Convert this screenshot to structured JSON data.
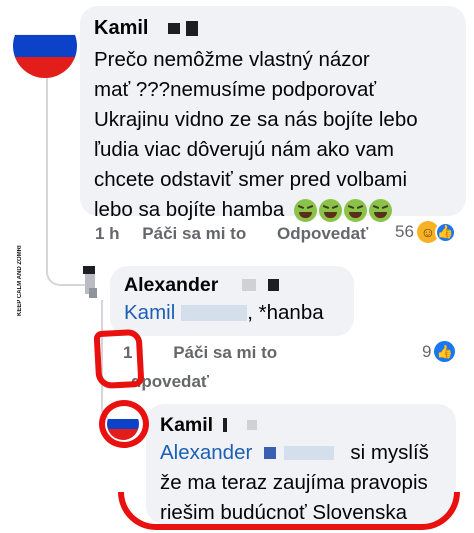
{
  "comment_1": {
    "author": "Kamil",
    "lines": [
      "Prečo nemôžme  vlastný názor",
      "mať ???nemusíme podporovať",
      "Ukrajinu vidno ze sa nás bojíte lebo",
      "ľudia viac dôverujú nám ako vam",
      "chcete odstaviť smer pred volbami",
      "lebo sa bojíte hamba"
    ],
    "emoji_name": "nauseated-face-emoji",
    "emoji_count": 4,
    "time": "1 h",
    "like_label": "Páči sa mi to",
    "reply_label": "Odpovedať",
    "reaction_count": "56",
    "reaction_icons": [
      "laugh-icon",
      "like-icon"
    ]
  },
  "reply_1": {
    "author": "Alexander",
    "mention": "Kamil",
    "text": ", *hanba",
    "time": "1",
    "like_label": "Páči sa mi to",
    "reply_label": "dpovedať",
    "reaction_count": "9",
    "reaction_icons": [
      "like-icon"
    ]
  },
  "reply_2": {
    "author": "Kamil",
    "mention": "Alexander",
    "line1_rest": "si myslíš",
    "line2": "že ma teraz zaujíma pravopis",
    "line3": "riešim budúcnoť Slovenska"
  },
  "watermark": "KEEP CALM AND ZOMRI",
  "colors": {
    "bubble": "#f0f2f5",
    "meta_text": "#65676b",
    "mention": "#1d5fb4",
    "annotation_red": "#e8110f",
    "like_blue": "#1877f2",
    "flag_white": "#ffffff",
    "flag_blue": "#0b42c8",
    "flag_red": "#e31d1a"
  }
}
